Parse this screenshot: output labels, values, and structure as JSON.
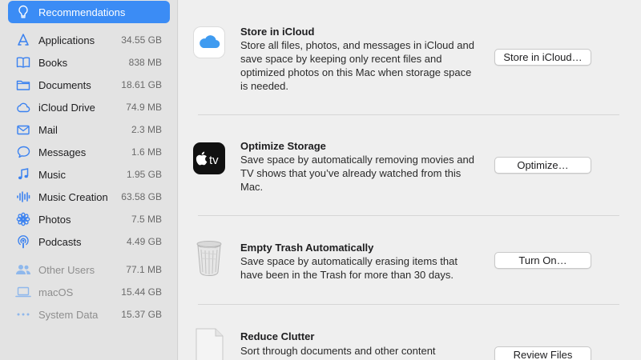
{
  "sidebar": {
    "items": [
      {
        "label": "Recommendations",
        "size": "",
        "icon": "lightbulb-icon",
        "selected": true
      },
      {
        "label": "Applications",
        "size": "34.55 GB",
        "icon": "applications-icon"
      },
      {
        "label": "Books",
        "size": "838 MB",
        "icon": "book-icon"
      },
      {
        "label": "Documents",
        "size": "18.61 GB",
        "icon": "document-icon"
      },
      {
        "label": "iCloud Drive",
        "size": "74.9 MB",
        "icon": "cloud-icon"
      },
      {
        "label": "Mail",
        "size": "2.3 MB",
        "icon": "mail-icon"
      },
      {
        "label": "Messages",
        "size": "1.6 MB",
        "icon": "message-bubble-icon"
      },
      {
        "label": "Music",
        "size": "1.95 GB",
        "icon": "music-note-icon"
      },
      {
        "label": "Music Creation",
        "size": "63.58 GB",
        "icon": "waveform-icon"
      },
      {
        "label": "Photos",
        "size": "7.5 MB",
        "icon": "flower-icon"
      },
      {
        "label": "Podcasts",
        "size": "4.49 GB",
        "icon": "podcast-icon"
      },
      {
        "label": "Other Users",
        "size": "77.1 MB",
        "icon": "users-icon"
      },
      {
        "label": "macOS",
        "size": "15.44 GB",
        "icon": "laptop-icon"
      },
      {
        "label": "System Data",
        "size": "15.37 GB",
        "icon": "ellipsis-icon"
      }
    ]
  },
  "recommendations": [
    {
      "title": "Store in iCloud",
      "description": "Store all files, photos, and messages in iCloud and save space by keeping only recent files and optimized photos on this Mac when storage space is needed.",
      "button": "Store in iCloud…",
      "icon": "icloud-app-icon"
    },
    {
      "title": "Optimize Storage",
      "description": "Save space by automatically removing movies and TV shows that you’ve already watched from this Mac.",
      "button": "Optimize…",
      "icon": "apple-tv-app-icon",
      "icon_text": "tv"
    },
    {
      "title": "Empty Trash Automatically",
      "description": "Save space by automatically erasing items that have been in the Trash for more than 30 days.",
      "button": "Turn On…",
      "icon": "trash-can-icon"
    },
    {
      "title": "Reduce Clutter",
      "description": "Sort through documents and other content",
      "button": "Review Files",
      "icon": "document-file-icon"
    }
  ],
  "colors": {
    "accent": "#3b8cf5",
    "sidebar_icon": "#3b82f0",
    "sidebar_icon_dim": "#8fb8ec"
  }
}
